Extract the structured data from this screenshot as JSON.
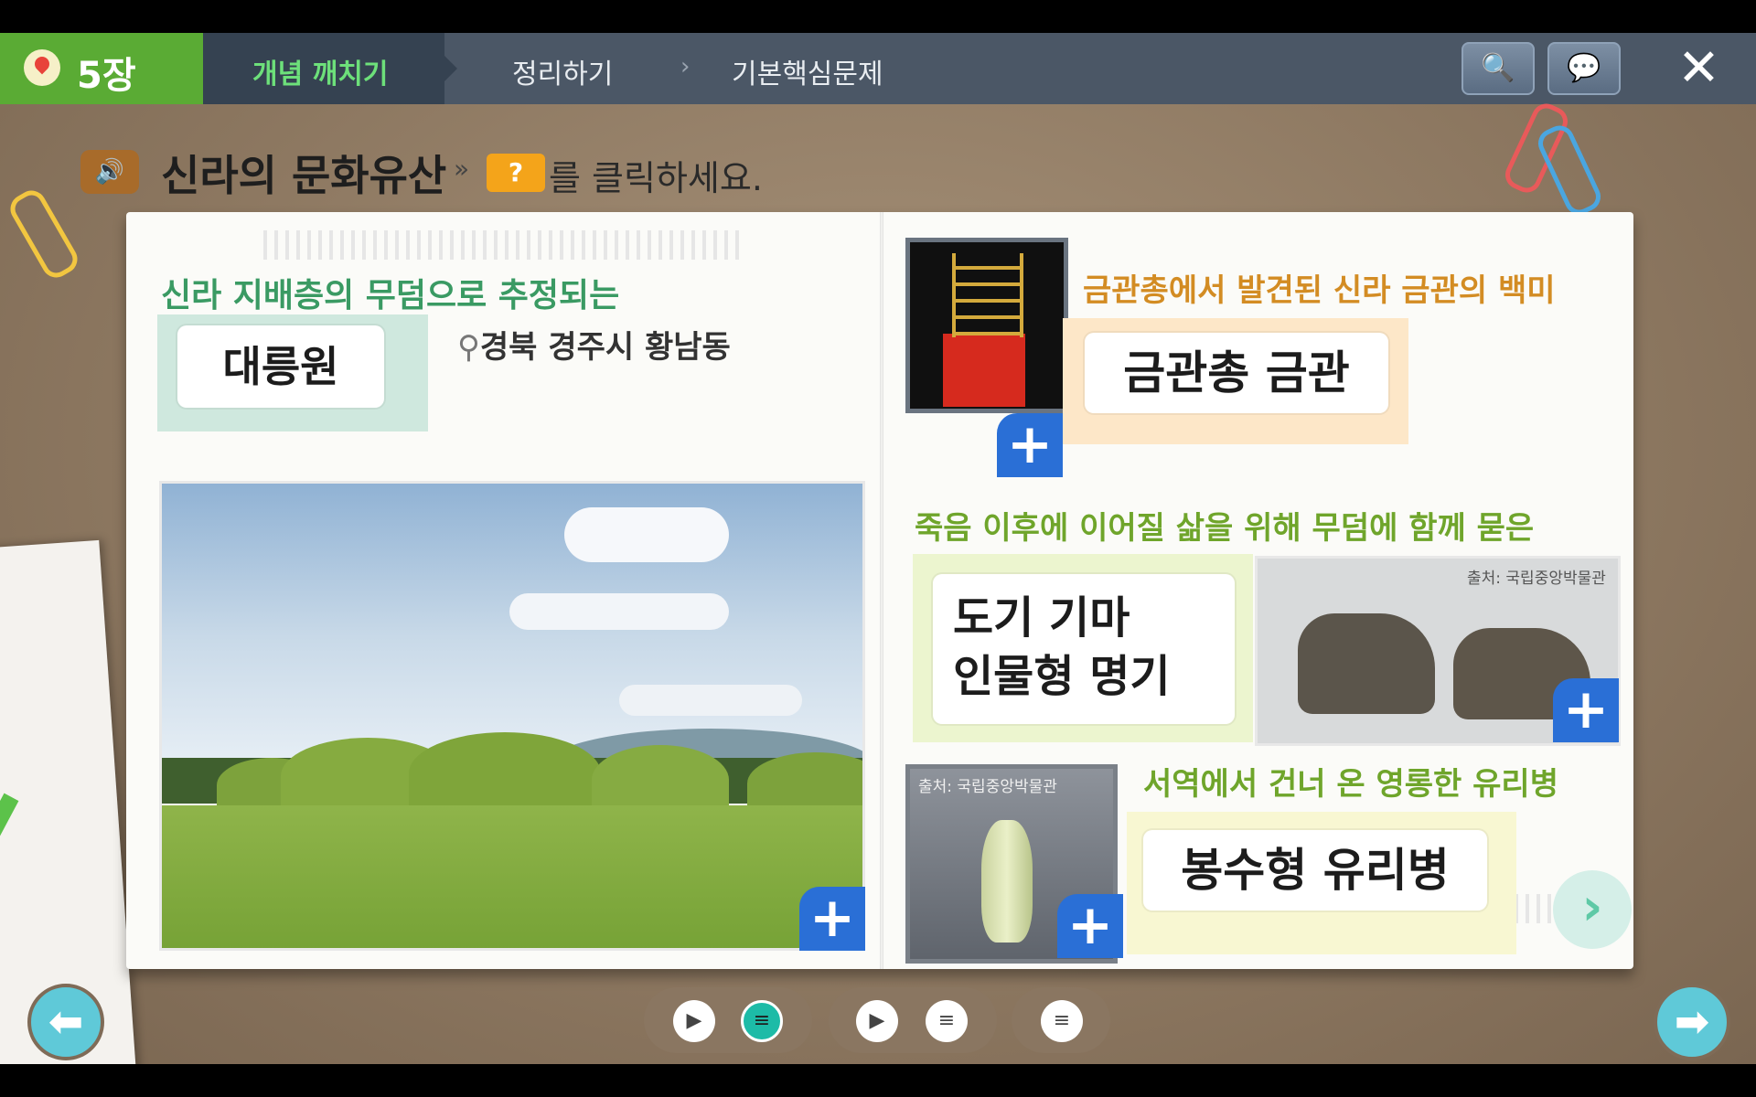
{
  "nav": {
    "chapter": "5장",
    "tabs": [
      "개념 깨치기",
      "정리하기",
      "기본핵심문제"
    ],
    "tab_chevron": "›",
    "tools": [
      {
        "icon": "dictionary-search-icon",
        "glyph": "🔍"
      },
      {
        "icon": "chat-icon",
        "glyph": "💬"
      }
    ],
    "close": "✕"
  },
  "header": {
    "title": "신라의 문화유산",
    "separator": "»",
    "question_badge": "?",
    "instruction": "를 클릭하세요."
  },
  "left_page": {
    "lead": "신라 지배층의 무덤으로 추정되는",
    "label": "대릉원",
    "location": "경북 경주시 황남동",
    "plus": "+"
  },
  "right_page": {
    "items": [
      {
        "lead": "금관총에서 발견된 신라 금관의 백미",
        "label": "금관총 금관",
        "credit": ""
      },
      {
        "lead": "죽음 이후에 이어질 삶을 위해 무덤에 함께 묻은",
        "label_lines": [
          "도기 기마",
          "인물형 명기"
        ],
        "credit": "출처: 국립중앙박물관"
      },
      {
        "lead": "서역에서 건너 온 영롱한 유리병",
        "label": "봉수형 유리병",
        "credit": "출처: 국립중앙박물관"
      }
    ],
    "plus": "+",
    "next": "›"
  },
  "controls": {
    "play": "▶",
    "script": "≡",
    "prev": "⬅",
    "next": "➡"
  },
  "colors": {
    "nav_bg": "#4b5766",
    "chapter_green": "#5aab34",
    "active_tab_text": "#6de07a",
    "plus_blue": "#2a6fd6",
    "lead_green": "#3a9a63",
    "lead_olive": "#6fa52b",
    "lead_orange": "#d38c23"
  }
}
